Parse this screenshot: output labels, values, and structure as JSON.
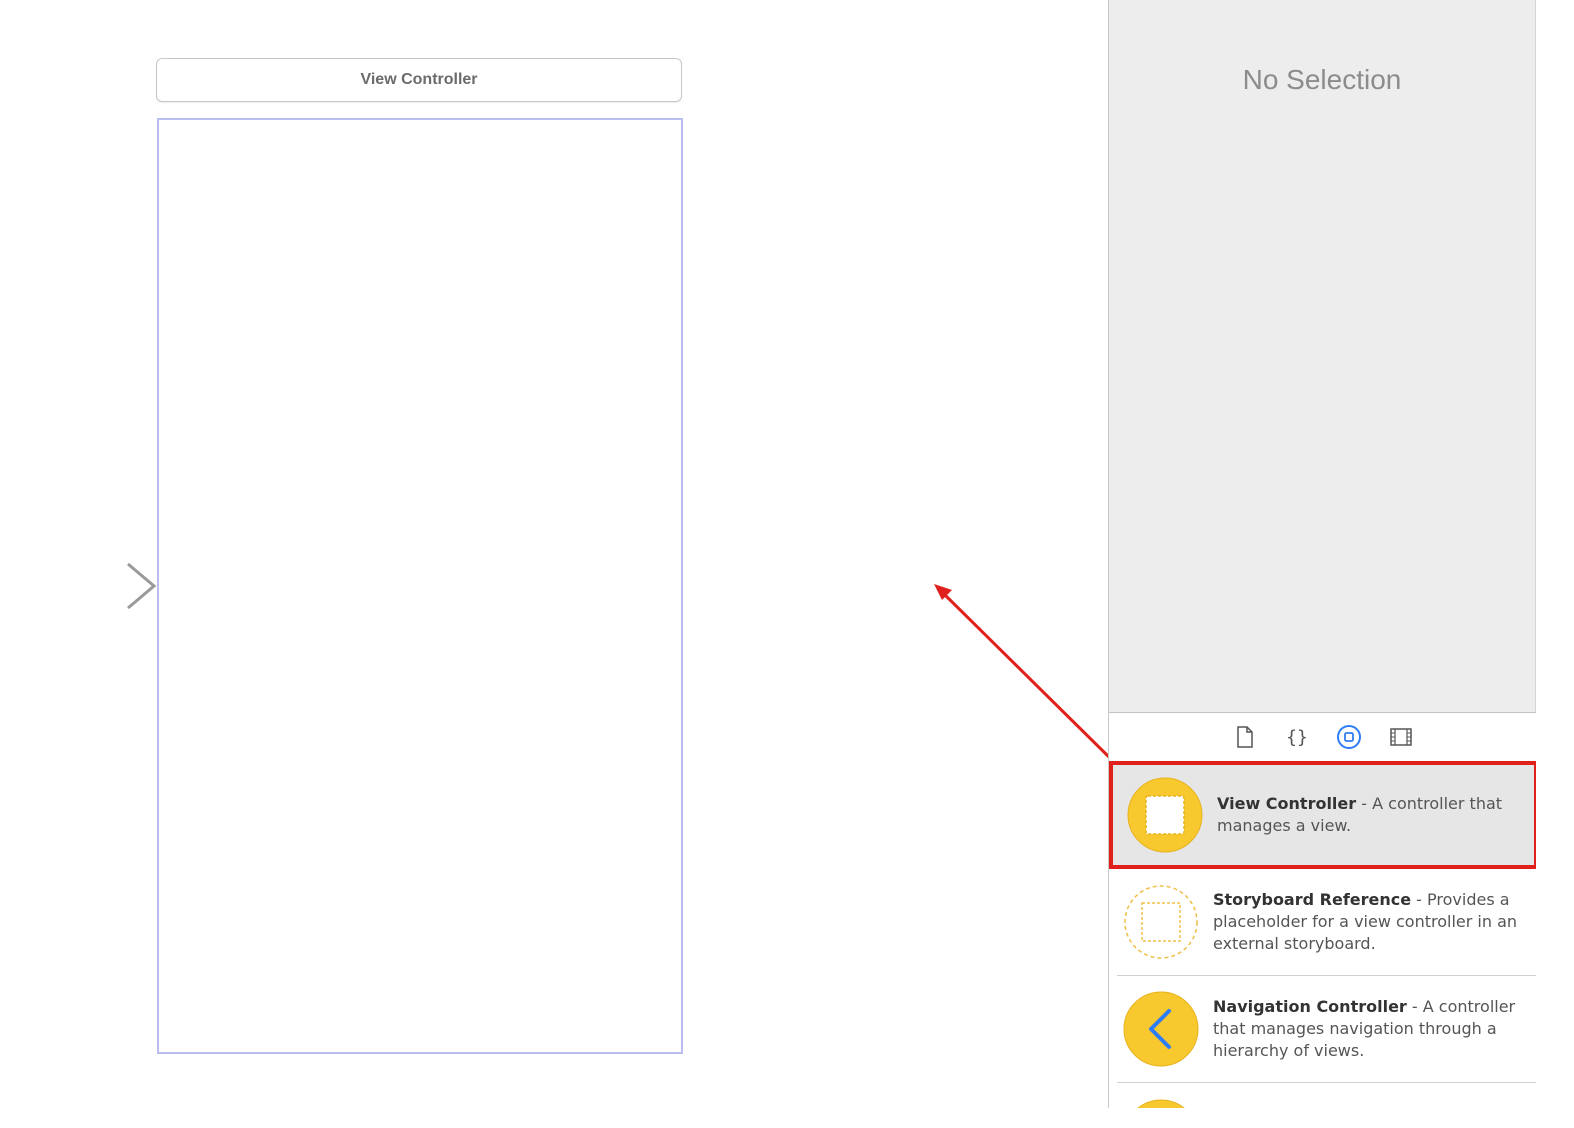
{
  "canvas": {
    "scene_title": "View Controller"
  },
  "inspector": {
    "empty_state": "No Selection"
  },
  "library": {
    "tabs": [
      {
        "icon": "file-template-icon"
      },
      {
        "icon": "code-snippet-icon"
      },
      {
        "icon": "object-library-icon",
        "selected": true
      },
      {
        "icon": "media-library-icon"
      }
    ],
    "items": [
      {
        "name": "View Controller",
        "sep": " - ",
        "description": "A controller that manages a view.",
        "icon": "view-controller-icon",
        "selected": true
      },
      {
        "name": "Storyboard Reference",
        "sep": " - ",
        "description": "Provides a placeholder for a view controller in an external storyboard.",
        "icon": "storyboard-reference-icon"
      },
      {
        "name": "Navigation Controller",
        "sep": " - ",
        "description": "A controller that manages navigation through a hierarchy of views.",
        "icon": "navigation-controller-icon"
      }
    ]
  },
  "colors": {
    "highlight": "#e0201b",
    "icon_yellow": "#f8c92e",
    "accent_blue": "#2f7df6"
  }
}
